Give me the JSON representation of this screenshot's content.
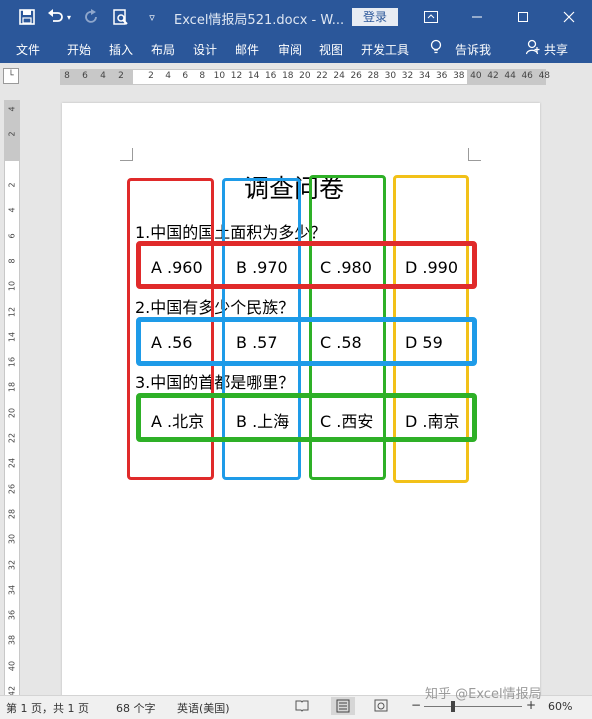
{
  "titlebar": {
    "doc_title": "Excel情报局521.docx - W...",
    "login_label": "登录",
    "icons": [
      "save-icon",
      "undo-icon",
      "redo-icon",
      "print-preview-icon",
      "customize-toolbar-icon",
      "ribbon-display-icon",
      "minimize-icon",
      "maximize-icon",
      "close-icon"
    ]
  },
  "menu": {
    "items": [
      "文件",
      "开始",
      "插入",
      "布局",
      "设计",
      "邮件",
      "审阅",
      "视图",
      "开发工具",
      "告诉我"
    ],
    "share_label": "共享"
  },
  "ruler": {
    "h_ticks": [
      "8",
      "6",
      "4",
      "2",
      "2",
      "4",
      "6",
      "8",
      "10",
      "12",
      "14",
      "16",
      "18",
      "20",
      "22",
      "24",
      "26",
      "28",
      "30",
      "32",
      "34",
      "36",
      "38",
      "40",
      "42",
      "44",
      "46",
      "48"
    ],
    "v_ticks": [
      "4",
      "2",
      "2",
      "4",
      "6",
      "8",
      "10",
      "12",
      "14",
      "16",
      "18",
      "20",
      "22",
      "24",
      "26",
      "28",
      "30",
      "32",
      "34",
      "36",
      "38",
      "40",
      "42"
    ]
  },
  "document": {
    "title": "调查问卷",
    "questions": [
      {
        "text": "1.中国的国土面积为多少？",
        "options": [
          "A .960",
          "B .970",
          "C .980",
          "D .990"
        ]
      },
      {
        "text": "2.中国有多少个民族？",
        "options": [
          "A .56",
          "B .57",
          "C .58",
          "D 59"
        ]
      },
      {
        "text": "3.中国的首都是哪里？",
        "options": [
          "A .北京",
          "B .上海",
          "C .西安",
          "D .南京"
        ]
      }
    ]
  },
  "highlight_colors": {
    "red": "#e02a2a",
    "blue": "#1e9be8",
    "green": "#2eb027",
    "yellow": "#f2c118"
  },
  "statusbar": {
    "page": "第 1 页，共 1 页",
    "words": "68 个字",
    "language": "英语(美国)",
    "zoom": "60%",
    "zoom_level": 0.6
  },
  "watermark": "知乎 @Excel情报局"
}
